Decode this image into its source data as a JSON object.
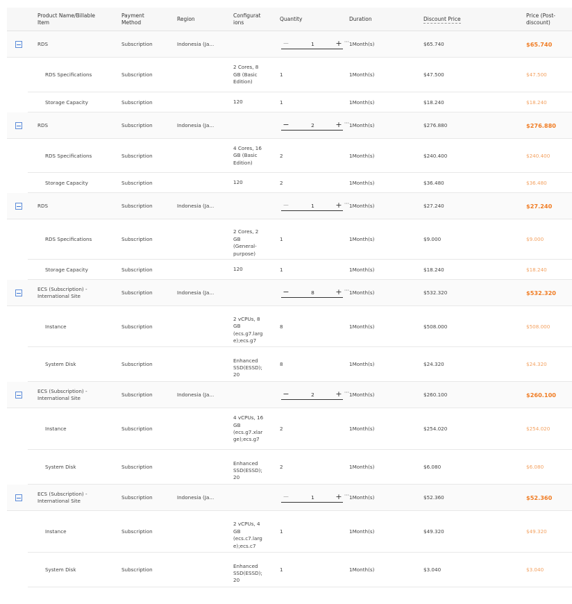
{
  "headers": {
    "name": "Product Name/Billable Item",
    "payment": "Payment Method",
    "region": "Region",
    "config": "Configurations",
    "quantity": "Quantity",
    "duration": "Duration",
    "discount": "Discount Price",
    "price": "Price (Post-discount)"
  },
  "groups": [
    {
      "parent": {
        "name": "RDS",
        "payment": "Subscription",
        "region": "Indonesia (Ja...",
        "qty": "1",
        "duration": "1Month(s)",
        "discount": "$65.740",
        "price": "$65.740"
      },
      "children": [
        {
          "name": "RDS Specifications",
          "payment": "Subscription",
          "config": "2 Cores, 8 GB (Basic Edition)",
          "qty": "1",
          "duration": "1Month(s)",
          "discount": "$47.500",
          "price": "$47.500"
        },
        {
          "name": "Storage Capacity",
          "payment": "Subscription",
          "config": "120",
          "qty": "1",
          "duration": "1Month(s)",
          "discount": "$18.240",
          "price": "$18.240"
        }
      ]
    },
    {
      "parent": {
        "name": "RDS",
        "payment": "Subscription",
        "region": "Indonesia (Ja...",
        "qty": "2",
        "duration": "1Month(s)",
        "discount": "$276.880",
        "price": "$276.880"
      },
      "children": [
        {
          "name": "RDS Specifications",
          "payment": "Subscription",
          "config": "4 Cores, 16 GB (Basic Edition)",
          "qty": "2",
          "duration": "1Month(s)",
          "discount": "$240.400",
          "price": "$240.400"
        },
        {
          "name": "Storage Capacity",
          "payment": "Subscription",
          "config": "120",
          "qty": "2",
          "duration": "1Month(s)",
          "discount": "$36.480",
          "price": "$36.480"
        }
      ]
    },
    {
      "parent": {
        "name": "RDS",
        "payment": "Subscription",
        "region": "Indonesia (Ja...",
        "qty": "1",
        "duration": "1Month(s)",
        "discount": "$27.240",
        "price": "$27.240"
      },
      "children": [
        {
          "name": "RDS Specifications",
          "payment": "Subscription",
          "config": "2 Cores, 2 GB (General-purpose)",
          "qty": "1",
          "duration": "1Month(s)",
          "discount": "$9.000",
          "price": "$9.000"
        },
        {
          "name": "Storage Capacity",
          "payment": "Subscription",
          "config": "120",
          "qty": "1",
          "duration": "1Month(s)",
          "discount": "$18.240",
          "price": "$18.240"
        }
      ]
    },
    {
      "parent": {
        "name": "ECS (Subscription) - International Site",
        "payment": "Subscription",
        "region": "Indonesia (Ja...",
        "qty": "8",
        "duration": "1Month(s)",
        "discount": "$532.320",
        "price": "$532.320"
      },
      "children": [
        {
          "name": "Instance",
          "payment": "Subscription",
          "config": "2 vCPUs, 8 GB (ecs.g7.large);ecs.g7",
          "qty": "8",
          "duration": "1Month(s)",
          "discount": "$508.000",
          "price": "$508.000"
        },
        {
          "name": "System Disk",
          "payment": "Subscription",
          "config": "Enhanced SSD(ESSD); 20",
          "qty": "8",
          "duration": "1Month(s)",
          "discount": "$24.320",
          "price": "$24.320"
        }
      ]
    },
    {
      "parent": {
        "name": "ECS (Subscription) - International Site",
        "payment": "Subscription",
        "region": "Indonesia (Ja...",
        "qty": "2",
        "duration": "1Month(s)",
        "discount": "$260.100",
        "price": "$260.100"
      },
      "children": [
        {
          "name": "Instance",
          "payment": "Subscription",
          "config": "4 vCPUs, 16 GB (ecs.g7.xlarge);ecs.g7",
          "qty": "2",
          "duration": "1Month(s)",
          "discount": "$254.020",
          "price": "$254.020"
        },
        {
          "name": "System Disk",
          "payment": "Subscription",
          "config": "Enhanced SSD(ESSD); 20",
          "qty": "2",
          "duration": "1Month(s)",
          "discount": "$6.080",
          "price": "$6.080"
        }
      ]
    },
    {
      "parent": {
        "name": "ECS (Subscription) - International Site",
        "payment": "Subscription",
        "region": "Indonesia (Ja...",
        "qty": "1",
        "duration": "1Month(s)",
        "discount": "$52.360",
        "price": "$52.360"
      },
      "children": [
        {
          "name": "Instance",
          "payment": "Subscription",
          "config": "2 vCPUs, 4 GB (ecs.c7.large);ecs.c7",
          "qty": "1",
          "duration": "1Month(s)",
          "discount": "$49.320",
          "price": "$49.320"
        },
        {
          "name": "System Disk",
          "payment": "Subscription",
          "config": "Enhanced SSD(ESSD); 20",
          "qty": "1",
          "duration": "1Month(s)",
          "discount": "$3.040",
          "price": "$3.040"
        }
      ]
    }
  ],
  "icons": {
    "collapse": "minus-square-icon",
    "decrement": "minus-icon",
    "increment": "plus-icon",
    "more": "ellipsis-icon"
  },
  "colors": {
    "accent": "#f07c23",
    "accent_light": "#f3a160",
    "link": "#3a76d8"
  }
}
